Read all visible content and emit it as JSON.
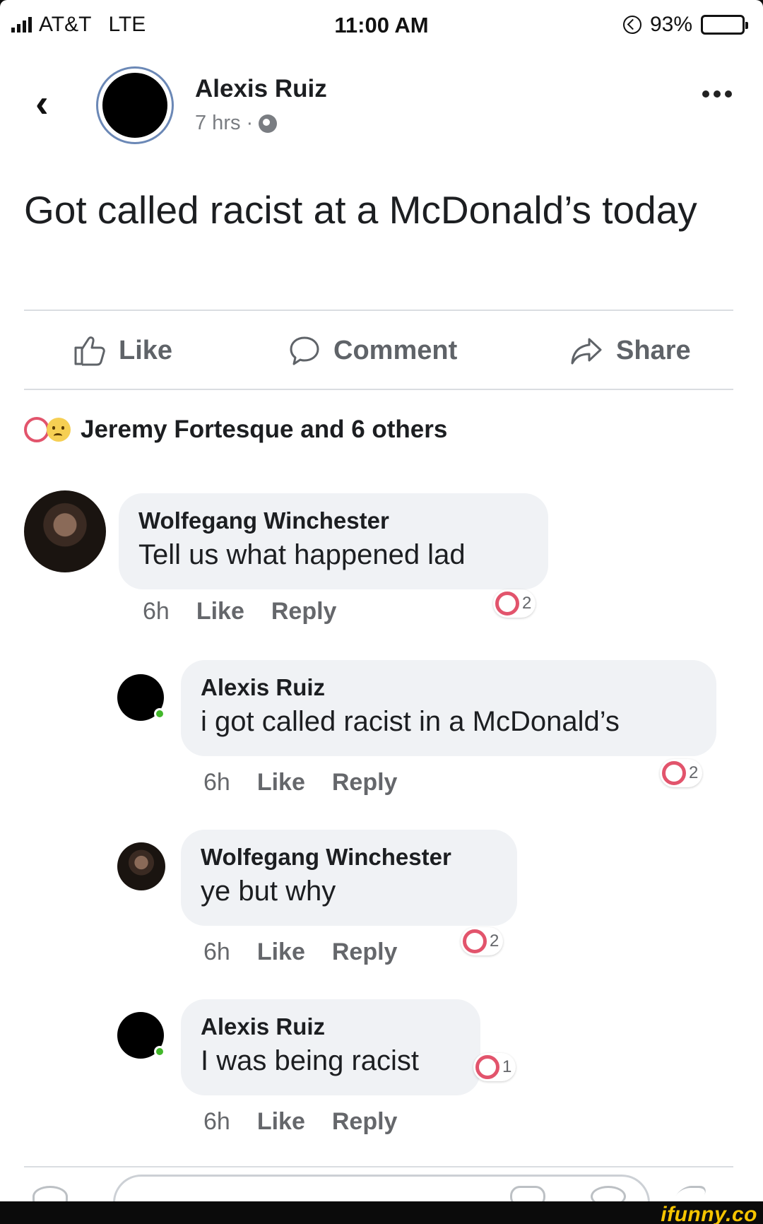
{
  "status_bar": {
    "carrier": "AT&T",
    "network": "LTE",
    "time": "11:00 AM",
    "battery": "93%",
    "battery_level": 0.93
  },
  "post": {
    "author": "Alexis Ruiz",
    "time": "7 hrs",
    "separator": "·",
    "text": "Got called racist at a McDonald’s today"
  },
  "actions": {
    "like": "Like",
    "comment": "Comment",
    "share": "Share"
  },
  "reactions_summary": "Jeremy Fortesque and 6 others",
  "comments": [
    {
      "name": "Wolfegang Winchester",
      "text": "Tell us what happened lad",
      "time": "6h",
      "like": "Like",
      "reply": "Reply",
      "reactions": "2"
    },
    {
      "name": "Alexis Ruiz",
      "text": "i got called racist in a McDonald’s",
      "time": "6h",
      "like": "Like",
      "reply": "Reply",
      "reactions": "2"
    },
    {
      "name": "Wolfegang Winchester",
      "text": "ye but why",
      "time": "6h",
      "like": "Like",
      "reply": "Reply",
      "reactions": "2"
    },
    {
      "name": "Alexis Ruiz",
      "text": "I was being racist",
      "time": "6h",
      "like": "Like",
      "reply": "Reply",
      "reactions": "1"
    }
  ],
  "watermark": "ifunny.co",
  "colors": {
    "heart": "#e2546c",
    "bubble": "#f0f2f5",
    "online": "#42b72a",
    "watermark": "#f5c400"
  }
}
